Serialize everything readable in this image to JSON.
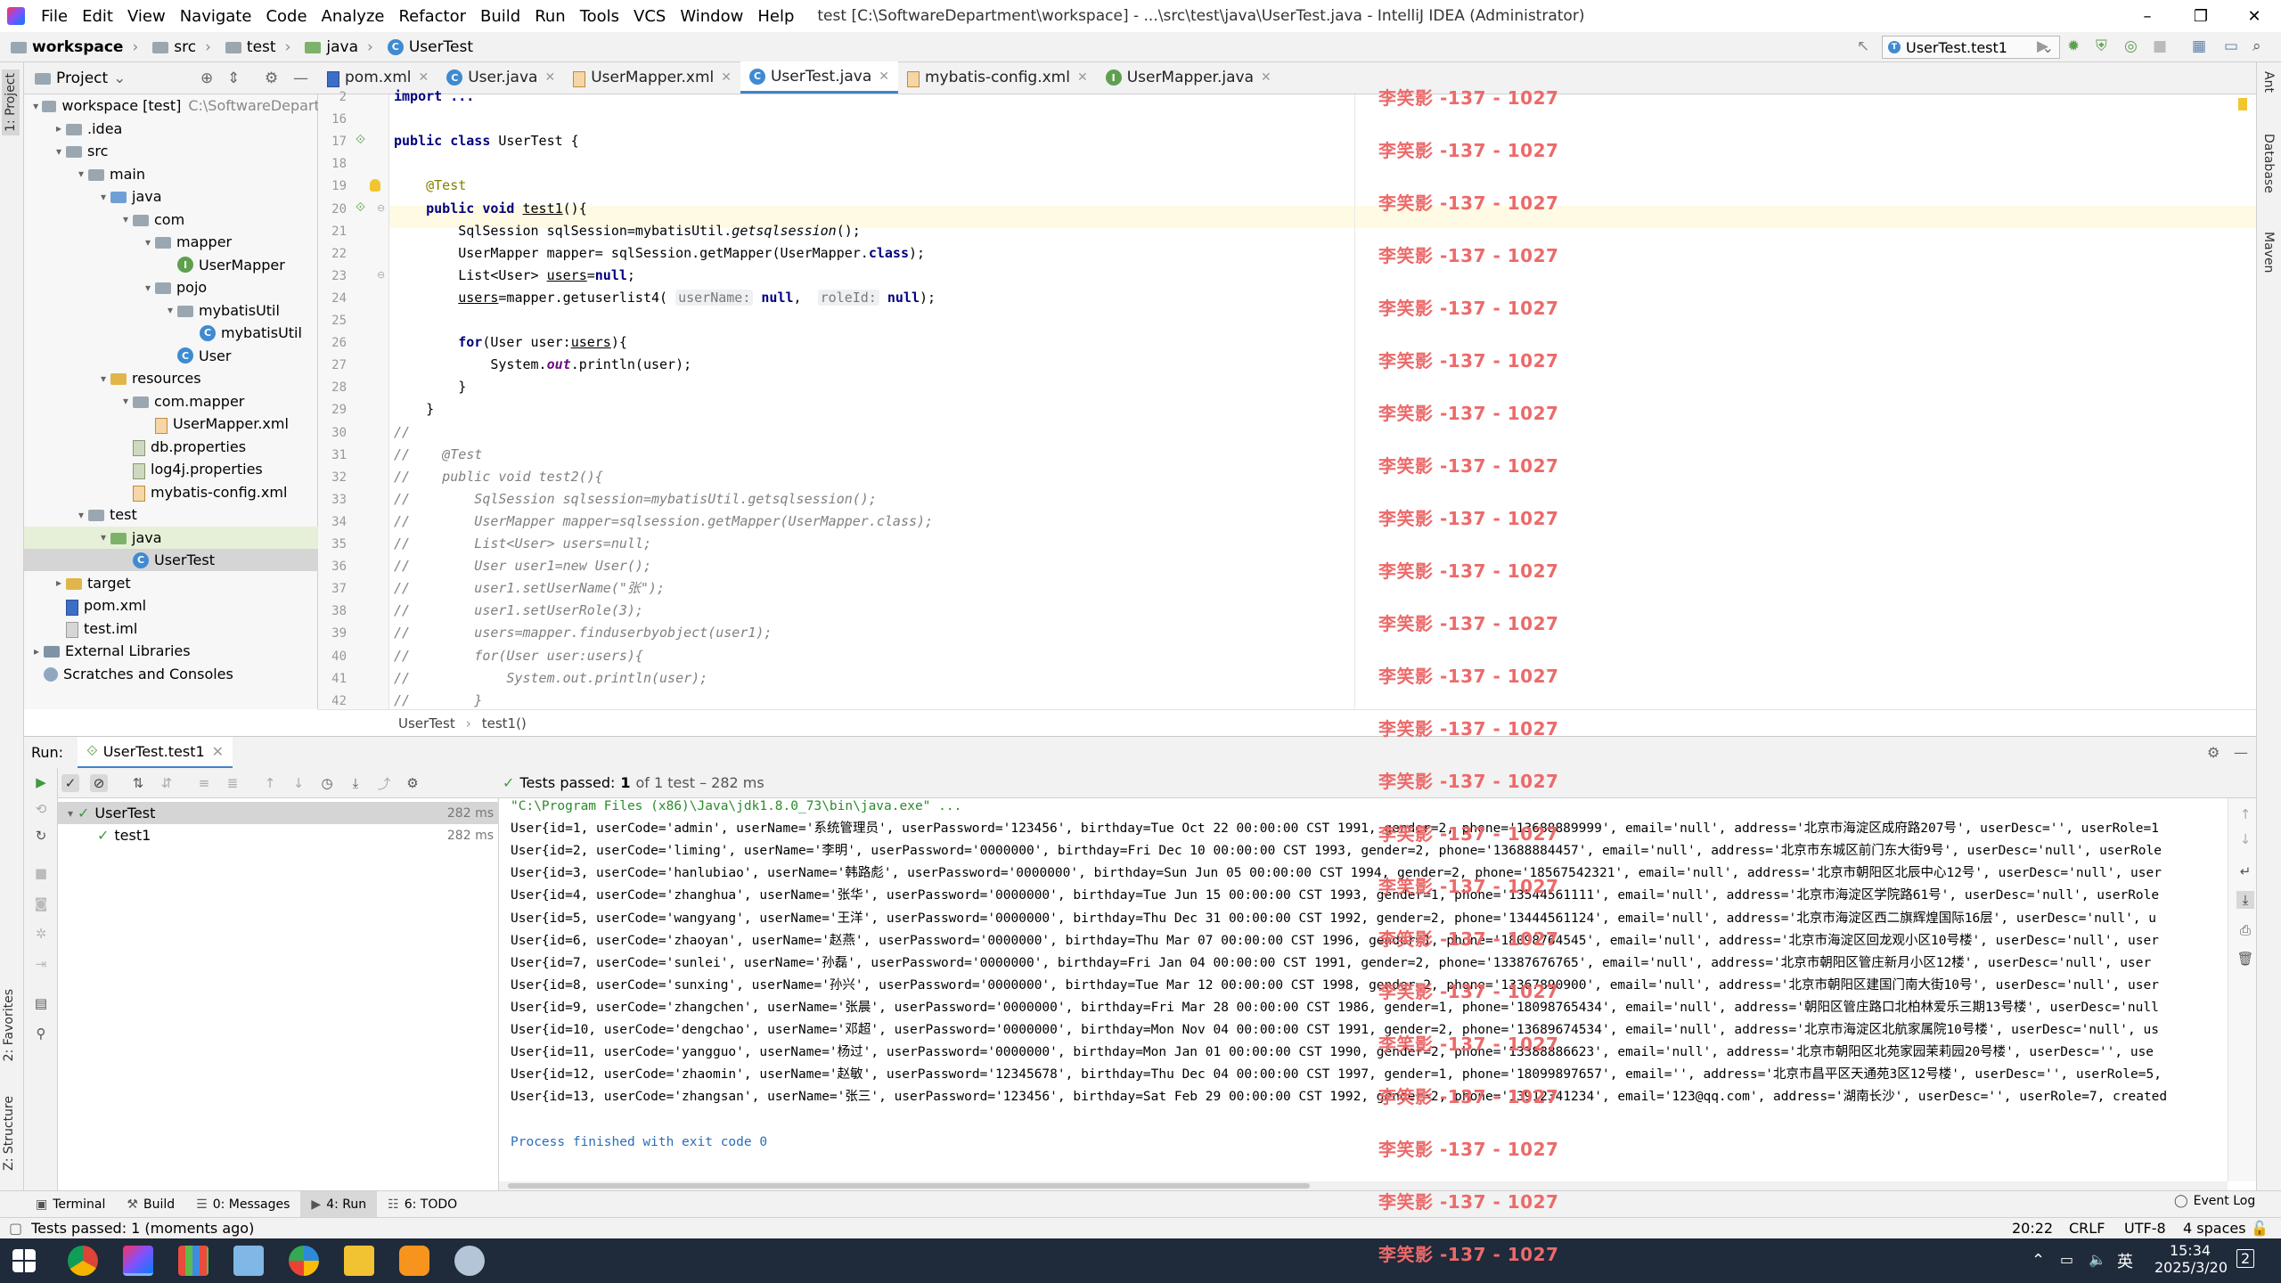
{
  "window": {
    "title": "test [C:\\SoftwareDepartment\\workspace] - ...\\src\\test\\java\\UserTest.java - IntelliJ IDEA (Administrator)",
    "minimize": "–",
    "maximize": "❐",
    "close": "✕"
  },
  "menu": [
    "File",
    "Edit",
    "View",
    "Navigate",
    "Code",
    "Analyze",
    "Refactor",
    "Build",
    "Run",
    "Tools",
    "VCS",
    "Window",
    "Help"
  ],
  "nav": {
    "crumbs": [
      "workspace",
      "src",
      "test",
      "java",
      "UserTest"
    ],
    "run_config": "UserTest.test1"
  },
  "project_panel": {
    "title": "Project",
    "tree": [
      {
        "label": "workspace [test]",
        "extra": "C:\\SoftwareDepartm",
        "depth": 0,
        "arrow": "▾",
        "icon": "folder"
      },
      {
        "label": ".idea",
        "depth": 1,
        "arrow": "▸",
        "icon": "folder"
      },
      {
        "label": "src",
        "depth": 1,
        "arrow": "▾",
        "icon": "folder"
      },
      {
        "label": "main",
        "depth": 2,
        "arrow": "▾",
        "icon": "folder"
      },
      {
        "label": "java",
        "depth": 3,
        "arrow": "▾",
        "icon": "folder-blue"
      },
      {
        "label": "com",
        "depth": 4,
        "arrow": "▾",
        "icon": "folder"
      },
      {
        "label": "mapper",
        "depth": 5,
        "arrow": "▾",
        "icon": "folder"
      },
      {
        "label": "UserMapper",
        "depth": 6,
        "arrow": "",
        "icon": "interface"
      },
      {
        "label": "pojo",
        "depth": 5,
        "arrow": "▾",
        "icon": "folder"
      },
      {
        "label": "mybatisUtil",
        "depth": 6,
        "arrow": "▾",
        "icon": "folder"
      },
      {
        "label": "mybatisUtil",
        "depth": 7,
        "arrow": "",
        "icon": "class"
      },
      {
        "label": "User",
        "depth": 6,
        "arrow": "",
        "icon": "class"
      },
      {
        "label": "resources",
        "depth": 3,
        "arrow": "▾",
        "icon": "folder-yellow"
      },
      {
        "label": "com.mapper",
        "depth": 4,
        "arrow": "▾",
        "icon": "folder"
      },
      {
        "label": "UserMapper.xml",
        "depth": 5,
        "arrow": "",
        "icon": "xml"
      },
      {
        "label": "db.properties",
        "depth": 4,
        "arrow": "",
        "icon": "prop"
      },
      {
        "label": "log4j.properties",
        "depth": 4,
        "arrow": "",
        "icon": "prop"
      },
      {
        "label": "mybatis-config.xml",
        "depth": 4,
        "arrow": "",
        "icon": "xml"
      },
      {
        "label": "test",
        "depth": 2,
        "arrow": "▾",
        "icon": "folder"
      },
      {
        "label": "java",
        "depth": 3,
        "arrow": "▾",
        "icon": "folder-green"
      },
      {
        "label": "UserTest",
        "depth": 4,
        "arrow": "",
        "icon": "class",
        "selected": true
      },
      {
        "label": "target",
        "depth": 1,
        "arrow": "▸",
        "icon": "folder-yellow"
      },
      {
        "label": "pom.xml",
        "depth": 1,
        "arrow": "",
        "icon": "m"
      },
      {
        "label": "test.iml",
        "depth": 1,
        "arrow": "",
        "icon": "file"
      },
      {
        "label": "External Libraries",
        "depth": 0,
        "arrow": "▸",
        "icon": "lib"
      },
      {
        "label": "Scratches and Consoles",
        "depth": 0,
        "arrow": "",
        "icon": "scratch"
      }
    ]
  },
  "editor_tabs": [
    {
      "label": "pom.xml",
      "icon": "m"
    },
    {
      "label": "User.java",
      "icon": "class"
    },
    {
      "label": "UserMapper.xml",
      "icon": "xml"
    },
    {
      "label": "UserTest.java",
      "icon": "class",
      "active": true
    },
    {
      "label": "mybatis-config.xml",
      "icon": "xml"
    },
    {
      "label": "UserMapper.java",
      "icon": "interface"
    }
  ],
  "editor": {
    "line_numbers": [
      "2",
      "16",
      "17",
      "18",
      "19",
      "20",
      "21",
      "22",
      "23",
      "24",
      "25",
      "26",
      "27",
      "28",
      "29",
      "30",
      "31",
      "32",
      "33",
      "34",
      "35",
      "36",
      "37",
      "38",
      "39",
      "40",
      "41",
      "42"
    ],
    "lines": [
      [
        {
          "t": "import ...",
          "c": "kw"
        }
      ],
      [
        {
          "t": ""
        }
      ],
      [
        {
          "t": "public class ",
          "c": "kw"
        },
        {
          "t": "UserTest {"
        }
      ],
      [
        {
          "t": ""
        }
      ],
      [
        {
          "t": "    "
        },
        {
          "t": "@Test",
          "c": "ann"
        }
      ],
      [
        {
          "t": "    "
        },
        {
          "t": "public void ",
          "c": "kw"
        },
        {
          "t": "test1",
          "c": "und"
        },
        {
          "t": "(){"
        }
      ],
      [
        {
          "t": "        SqlSession sqlSession=mybatisUtil."
        },
        {
          "t": "getsqlsession",
          "c": "it"
        },
        {
          "t": "();"
        }
      ],
      [
        {
          "t": "        UserMapper mapper= sqlSession.getMapper(UserMapper."
        },
        {
          "t": "class",
          "c": "kw"
        },
        {
          "t": ");"
        }
      ],
      [
        {
          "t": "        List<User> "
        },
        {
          "t": "users",
          "c": "und"
        },
        {
          "t": "="
        },
        {
          "t": "null",
          "c": "kw"
        },
        {
          "t": ";"
        }
      ],
      [
        {
          "t": "        "
        },
        {
          "t": "users",
          "c": "und"
        },
        {
          "t": "=mapper.getuserlist4( "
        },
        {
          "t": "userName:",
          "c": "hint"
        },
        {
          "t": " "
        },
        {
          "t": "null",
          "c": "kw"
        },
        {
          "t": ",  "
        },
        {
          "t": "roleId:",
          "c": "hint"
        },
        {
          "t": " "
        },
        {
          "t": "null",
          "c": "kw"
        },
        {
          "t": ");"
        }
      ],
      [
        {
          "t": ""
        }
      ],
      [
        {
          "t": "        "
        },
        {
          "t": "for",
          "c": "kw"
        },
        {
          "t": "(User user:"
        },
        {
          "t": "users",
          "c": "und"
        },
        {
          "t": "){"
        }
      ],
      [
        {
          "t": "            System."
        },
        {
          "t": "out",
          "c": "fld"
        },
        {
          "t": ".println(user);"
        }
      ],
      [
        {
          "t": "        }"
        }
      ],
      [
        {
          "t": "    }"
        }
      ],
      [
        {
          "t": "//",
          "c": "cmt"
        }
      ],
      [
        {
          "t": "//    @Test",
          "c": "cmt"
        }
      ],
      [
        {
          "t": "//    public void test2(){",
          "c": "cmt"
        }
      ],
      [
        {
          "t": "//        SqlSession sqlsession=mybatisUtil.getsqlsession();",
          "c": "cmt"
        }
      ],
      [
        {
          "t": "//        UserMapper mapper=sqlsession.getMapper(UserMapper.class);",
          "c": "cmt"
        }
      ],
      [
        {
          "t": "//        List<User> users=null;",
          "c": "cmt"
        }
      ],
      [
        {
          "t": "//        User user1=new User();",
          "c": "cmt"
        }
      ],
      [
        {
          "t": "//        user1.setUserName(\"张\");",
          "c": "cmt"
        }
      ],
      [
        {
          "t": "//        user1.setUserRole(3);",
          "c": "cmt"
        }
      ],
      [
        {
          "t": "//        users=mapper.finduserbyobject(user1);",
          "c": "cmt"
        }
      ],
      [
        {
          "t": "//        for(User user:users){",
          "c": "cmt"
        }
      ],
      [
        {
          "t": "//            System.out.println(user);",
          "c": "cmt"
        }
      ],
      [
        {
          "t": "//        }",
          "c": "cmt"
        }
      ]
    ],
    "breadcrumb": [
      "UserTest",
      "test1()"
    ]
  },
  "watermark": "李笑影 -137 - 1027",
  "run_panel": {
    "label": "Run:",
    "tab": "UserTest.test1",
    "status_prefix": "Tests passed:",
    "status_count": "1",
    "status_suffix": "of 1 test – 282 ms",
    "tree": [
      {
        "label": "UserTest",
        "time": "282 ms",
        "depth": 0
      },
      {
        "label": "test1",
        "time": "282 ms",
        "depth": 1
      }
    ],
    "console": [
      "\"C:\\Program Files (x86)\\Java\\jdk1.8.0_73\\bin\\java.exe\" ...",
      "User{id=1, userCode='admin', userName='系统管理员', userPassword='123456', birthday=Tue Oct 22 00:00:00 CST 1991, gender=2, phone='13688889999', email='null', address='北京市海淀区成府路207号', userDesc='', userRole=1",
      "User{id=2, userCode='liming', userName='李明', userPassword='0000000', birthday=Fri Dec 10 00:00:00 CST 1993, gender=2, phone='13688884457', email='null', address='北京市东城区前门东大街9号', userDesc='null', userRole",
      "User{id=3, userCode='hanlubiao', userName='韩路彪', userPassword='0000000', birthday=Sun Jun 05 00:00:00 CST 1994, gender=2, phone='18567542321', email='null', address='北京市朝阳区北辰中心12号', userDesc='null', user",
      "User{id=4, userCode='zhanghua', userName='张华', userPassword='0000000', birthday=Tue Jun 15 00:00:00 CST 1993, gender=1, phone='13544561111', email='null', address='北京市海淀区学院路61号', userDesc='null', userRole",
      "User{id=5, userCode='wangyang', userName='王洋', userPassword='0000000', birthday=Thu Dec 31 00:00:00 CST 1992, gender=2, phone='13444561124', email='null', address='北京市海淀区西二旗辉煌国际16层', userDesc='null', u",
      "User{id=6, userCode='zhaoyan', userName='赵燕', userPassword='0000000', birthday=Thu Mar 07 00:00:00 CST 1996, gender=1, phone='18098764545', email='null', address='北京市海淀区回龙观小区10号楼', userDesc='null', user",
      "User{id=7, userCode='sunlei', userName='孙磊', userPassword='0000000', birthday=Fri Jan 04 00:00:00 CST 1991, gender=2, phone='13387676765', email='null', address='北京市朝阳区管庄新月小区12楼', userDesc='null', user",
      "User{id=8, userCode='sunxing', userName='孙兴', userPassword='0000000', birthday=Tue Mar 12 00:00:00 CST 1998, gender=2, phone='13367890900', email='null', address='北京市朝阳区建国门南大街10号', userDesc='null', user",
      "User{id=9, userCode='zhangchen', userName='张晨', userPassword='0000000', birthday=Fri Mar 28 00:00:00 CST 1986, gender=1, phone='18098765434', email='null', address='朝阳区管庄路口北柏林爱乐三期13号楼', userDesc='null",
      "User{id=10, userCode='dengchao', userName='邓超', userPassword='0000000', birthday=Mon Nov 04 00:00:00 CST 1991, gender=2, phone='13689674534', email='null', address='北京市海淀区北航家属院10号楼', userDesc='null', us",
      "User{id=11, userCode='yangguo', userName='杨过', userPassword='0000000', birthday=Mon Jan 01 00:00:00 CST 1990, gender=2, phone='13388886623', email='null', address='北京市朝阳区北苑家园茉莉园20号楼', userDesc='', use",
      "User{id=12, userCode='zhaomin', userName='赵敏', userPassword='12345678', birthday=Thu Dec 04 00:00:00 CST 1997, gender=1, phone='18099897657', email='', address='北京市昌平区天通苑3区12号楼', userDesc='', userRole=5,",
      "User{id=13, userCode='zhangsan', userName='张三', userPassword='123456', birthday=Sat Feb 29 00:00:00 CST 1992, gender=2, phone='13912341234', email='123@qq.com', address='湖南长沙', userDesc='', userRole=7, created",
      "",
      "Process finished with exit code 0"
    ]
  },
  "bottom_tabs": [
    {
      "label": "Terminal"
    },
    {
      "label": "Build"
    },
    {
      "label": "0: Messages"
    },
    {
      "label": "4: Run",
      "active": true
    },
    {
      "label": "6: TODO"
    }
  ],
  "event_log": "Event Log",
  "left_tool_tabs": [
    "1: Project",
    "2: Favorites",
    "Z: Structure"
  ],
  "right_tool_tabs": [
    "Ant",
    "Database",
    "Maven"
  ],
  "status": {
    "message": "Tests passed: 1 (moments ago)",
    "position": "20:22",
    "line_sep": "CRLF",
    "encoding": "UTF-8",
    "indent": "4 spaces"
  },
  "taskbar": {
    "time": "15:34",
    "date": "2025/3/20",
    "ime": "英",
    "notif": "2"
  }
}
